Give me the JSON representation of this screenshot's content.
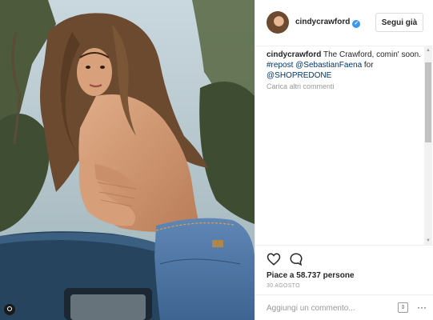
{
  "post": {
    "username": "cindycrawford",
    "verified_mark": "✓",
    "follow_label": "Segui già",
    "caption": {
      "author": "cindycrawford",
      "text": " The Crawford, comin' soon. ",
      "repost_tag": "#repost",
      "mention1": "@SebastianFaena",
      "for_text": " for ",
      "mention2": "@SHOPREDONE"
    },
    "load_more_label": "Carica altri commenti",
    "likes_text": "Piace a 58.737 persone",
    "date_text": "30 AGOSTO",
    "comment_placeholder": "Aggiungi un commento...",
    "more_glyph": "···",
    "icons": {
      "like": "heart-icon",
      "comment": "comment-bubble-icon",
      "tag": "user-tag-icon",
      "verified": "verified-badge-icon",
      "more": "more-options-icon"
    },
    "colors": {
      "verified_blue": "#3897f0",
      "text": "#262626",
      "muted": "#999999",
      "link": "#003569"
    }
  }
}
